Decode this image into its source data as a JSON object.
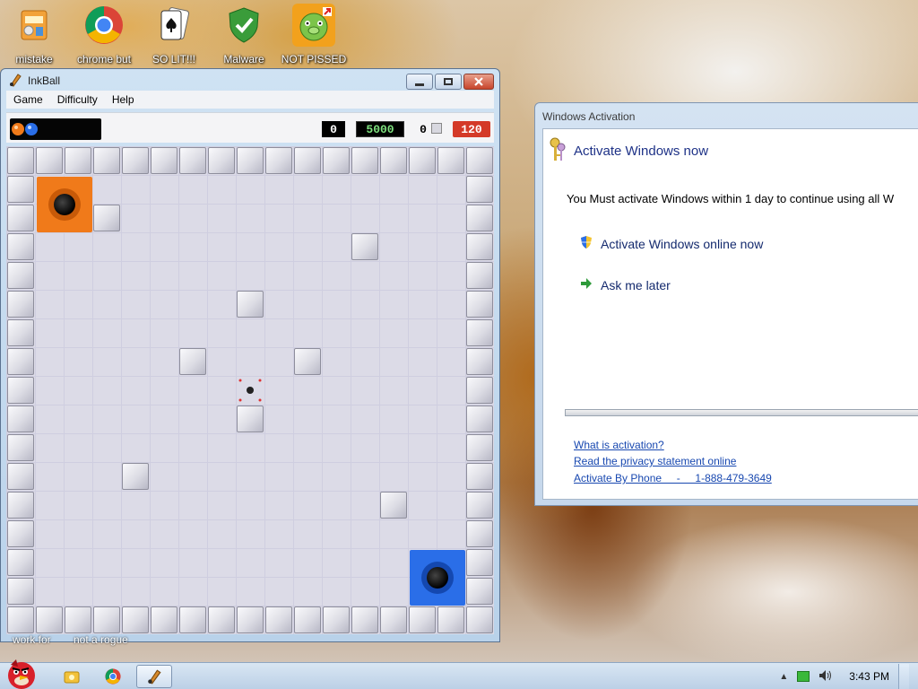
{
  "desktop": {
    "icons": [
      {
        "label": "mistake",
        "icon": "folder-app-icon"
      },
      {
        "label": "chrome but",
        "icon": "chrome-icon"
      },
      {
        "label": "SO LIT!!!",
        "icon": "playing-card-icon"
      },
      {
        "label": "Malware",
        "icon": "shield-check-icon"
      },
      {
        "label": "NOT PISSED",
        "icon": "angry-pig-icon"
      }
    ],
    "under_text": [
      "work for",
      "not a rogue"
    ]
  },
  "inkball": {
    "title": "InkBall",
    "menu": [
      "Game",
      "Difficulty",
      "Help"
    ],
    "score_left": "0",
    "score_main": "5000",
    "score_small": "0",
    "timer": "120",
    "colors": {
      "orange_hole": "#f07a1a",
      "blue_hole": "#2a6ee8",
      "timer_bg": "#d43a28"
    }
  },
  "activation": {
    "window_title": "Windows Activation",
    "heading": "Activate Windows now",
    "message": "You Must activate Windows within 1 day to continue using all W",
    "option_online": "Activate Windows online now",
    "option_later": "Ask me later",
    "links": [
      "What is activation?",
      "Read the privacy statement online",
      "Activate By Phone     -     1-888-479-3649"
    ]
  },
  "taskbar": {
    "clock": "3:43 PM",
    "tray_icons": [
      "show-hidden-icon",
      "network-icon",
      "volume-icon"
    ]
  }
}
